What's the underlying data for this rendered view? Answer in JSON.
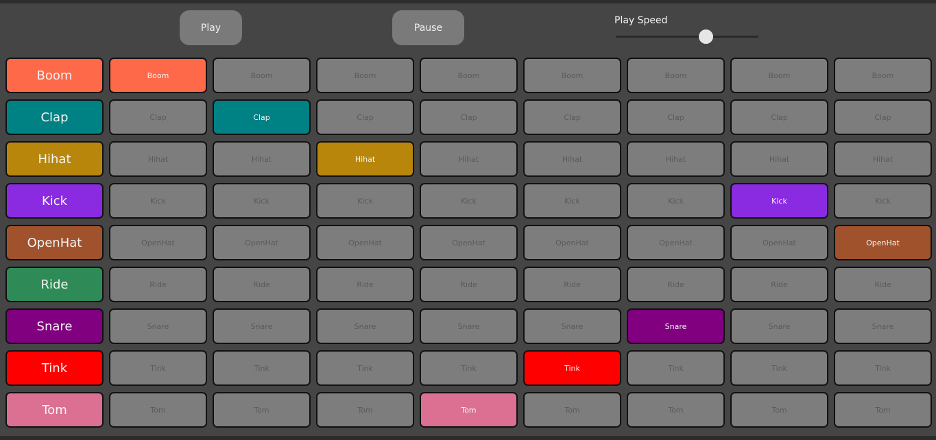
{
  "controls": {
    "play_label": "Play",
    "pause_label": "Pause",
    "speed_label": "Play Speed",
    "speed_value": 0.63
  },
  "grid": {
    "steps": 8,
    "inactive_color": "#7d7d7d",
    "instruments": [
      {
        "name": "Boom",
        "color": "#fe694a",
        "active_step": 0
      },
      {
        "name": "Clap",
        "color": "#008183",
        "active_step": 1
      },
      {
        "name": "Hihat",
        "color": "#b8860b",
        "active_step": 2
      },
      {
        "name": "Kick",
        "color": "#8a2be2",
        "active_step": 6
      },
      {
        "name": "OpenHat",
        "color": "#a0522d",
        "active_step": 7
      },
      {
        "name": "Ride",
        "color": "#2e8b57",
        "active_step": null
      },
      {
        "name": "Snare",
        "color": "#800080",
        "active_step": 5
      },
      {
        "name": "Tink",
        "color": "#ff0000",
        "active_step": 4
      },
      {
        "name": "Tom",
        "color": "#db7093",
        "active_step": 3
      }
    ]
  }
}
